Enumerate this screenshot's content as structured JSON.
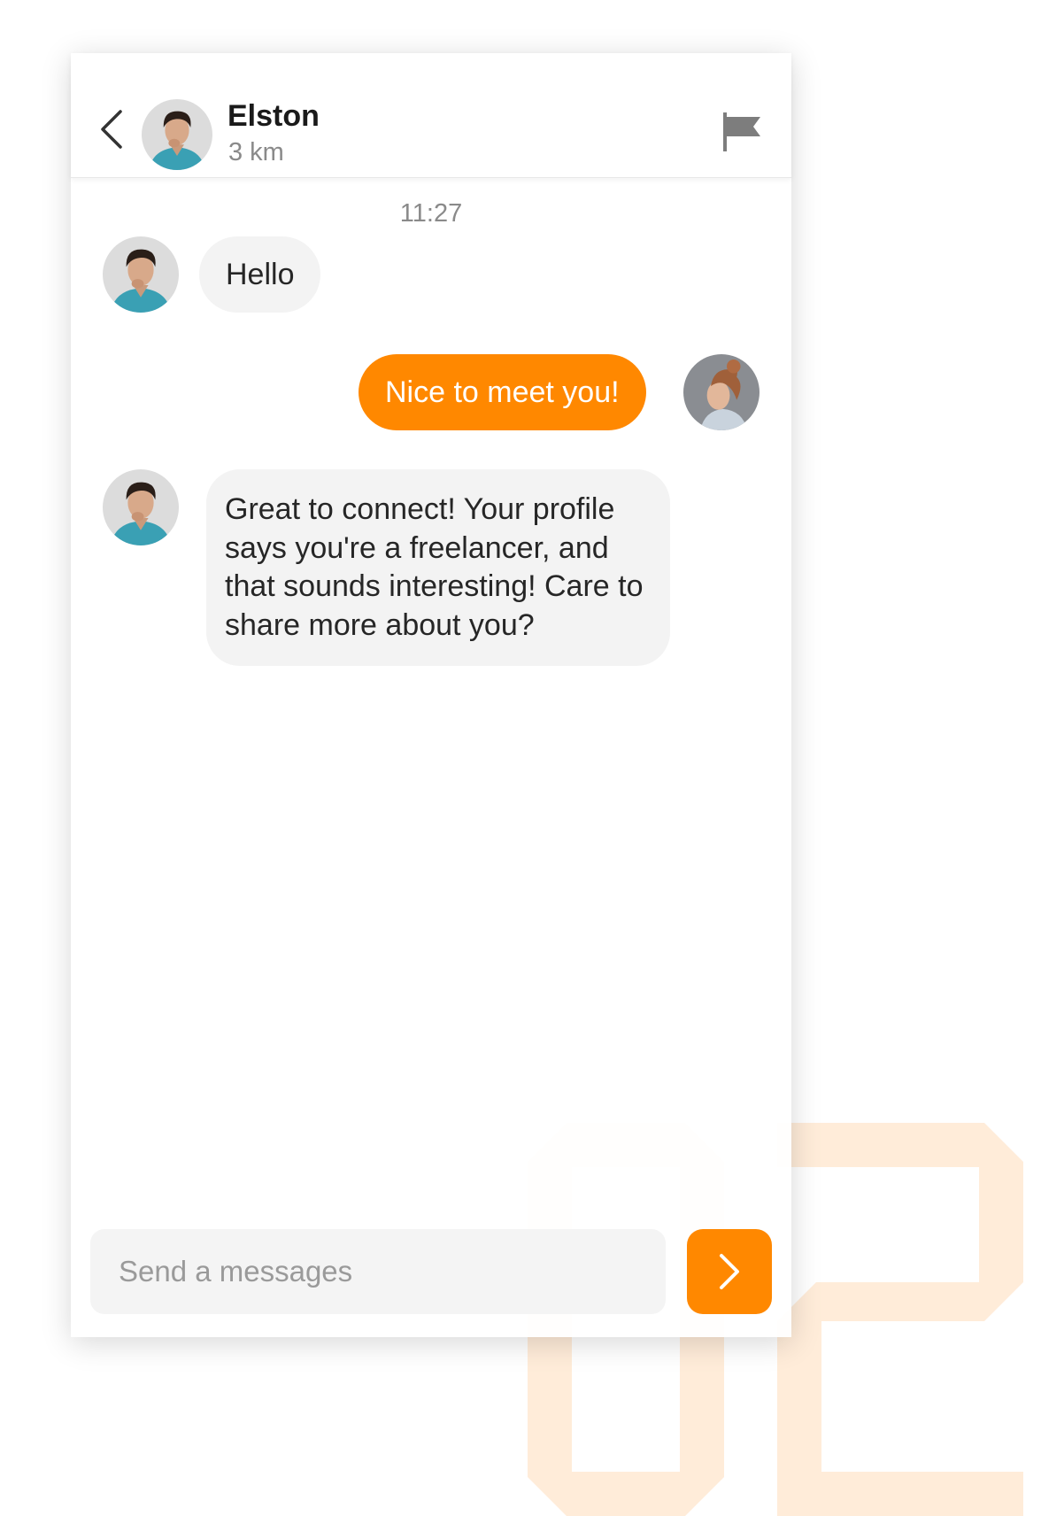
{
  "header": {
    "contact_name": "Elston",
    "contact_distance": "3 km",
    "back_icon": "chevron-left-icon",
    "flag_icon": "flag-icon"
  },
  "chat": {
    "timestamp": "11:27",
    "messages": [
      {
        "direction": "incoming",
        "text": "Hello"
      },
      {
        "direction": "outgoing",
        "text": "Nice to meet you!"
      },
      {
        "direction": "incoming",
        "text": "Great to connect! Your profile says you're a freelancer, and that sounds interesting! Care to share more about you?"
      }
    ]
  },
  "composer": {
    "placeholder": "Send a messages",
    "value": "",
    "send_icon": "chevron-right-icon"
  },
  "decoration": {
    "number": "02"
  },
  "colors": {
    "accent": "#ff8800",
    "incoming_bubble": "#f3f3f3",
    "decor_number": "#ffecd9"
  }
}
